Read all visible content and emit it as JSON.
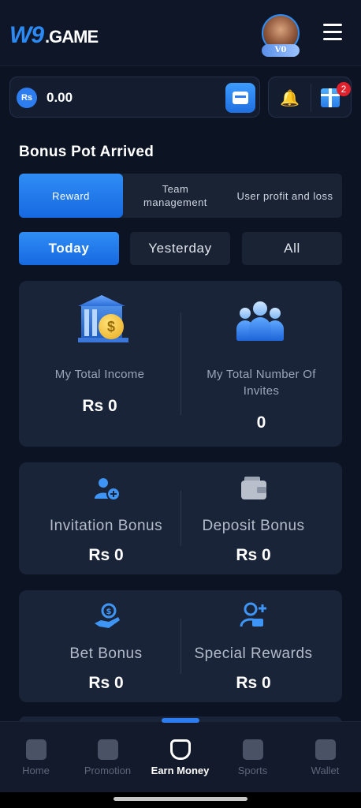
{
  "app": {
    "logo_main": "W9",
    "logo_suffix": ".GAME",
    "vip_label": "V0"
  },
  "balance": {
    "currency_symbol": "Rs",
    "amount": "0.00"
  },
  "notifications": {
    "gift_count": "2"
  },
  "section_title": "Bonus Pot Arrived",
  "tabs": [
    {
      "label": "Reward",
      "active": true
    },
    {
      "label": "Team management",
      "active": false
    },
    {
      "label": "User profit and loss",
      "active": false
    }
  ],
  "periods": [
    {
      "label": "Today",
      "active": true
    },
    {
      "label": "Yesterday",
      "active": false
    },
    {
      "label": "All",
      "active": false
    }
  ],
  "summary": {
    "income_label": "My Total Income",
    "income_value": "Rs 0",
    "invites_label": "My Total Number Of Invites",
    "invites_value": "0"
  },
  "bonuses": {
    "invitation_label": "Invitation Bonus",
    "invitation_value": "Rs 0",
    "deposit_label": "Deposit Bonus",
    "deposit_value": "Rs 0",
    "bet_label": "Bet Bonus",
    "bet_value": "Rs 0",
    "special_label": "Special Rewards",
    "special_value": "Rs 0"
  },
  "nav": [
    {
      "label": "Home",
      "icon": "home-icon",
      "active": false
    },
    {
      "label": "Promotion",
      "icon": "gift-icon",
      "active": false
    },
    {
      "label": "Earn Money",
      "icon": "money-bag-icon",
      "active": true
    },
    {
      "label": "Sports",
      "icon": "sports-icon",
      "active": false
    },
    {
      "label": "Wallet",
      "icon": "wallet-icon",
      "active": false
    }
  ],
  "colors": {
    "accent": "#2e7df0",
    "background": "#0c1424",
    "card": "#1a2438",
    "badge_red": "#e0202a"
  }
}
